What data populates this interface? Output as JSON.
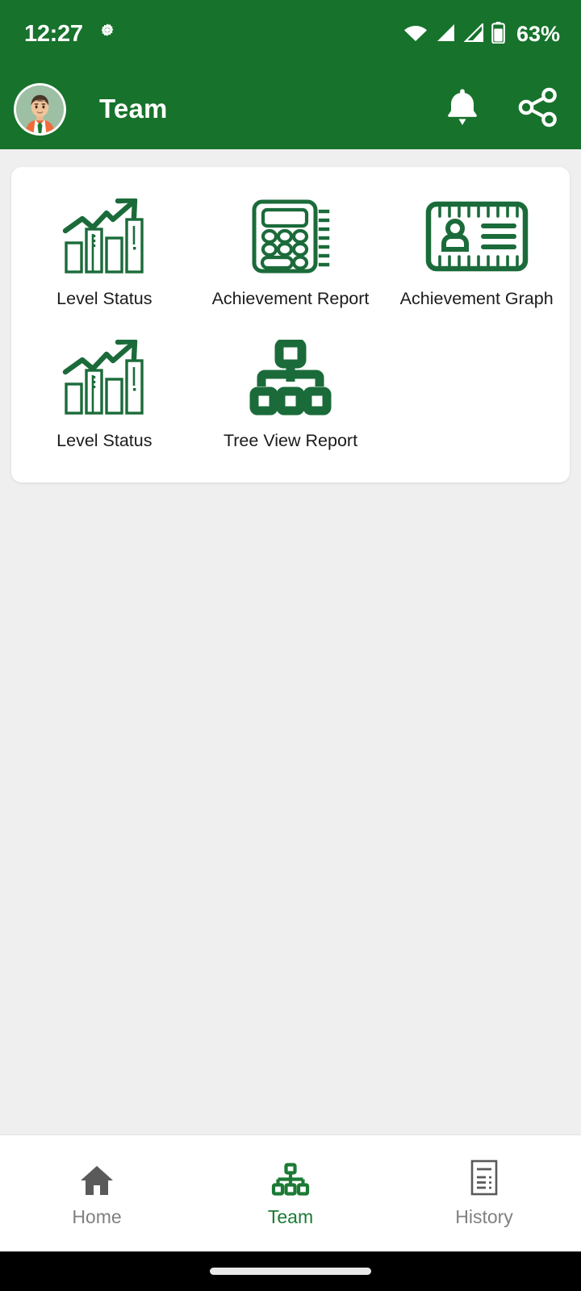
{
  "status_bar": {
    "time": "12:27",
    "battery_percent": "63%",
    "icons": [
      "gear-icon",
      "wifi-icon",
      "signal-icon",
      "signal-icon-2",
      "battery-icon"
    ]
  },
  "app_bar": {
    "title": "Team",
    "avatar_alt": "user-avatar",
    "actions": [
      {
        "name": "notifications-button",
        "icon": "bell-icon"
      },
      {
        "name": "share-button",
        "icon": "share-icon"
      }
    ]
  },
  "menu": {
    "items": [
      {
        "label": "Level Status",
        "icon": "growth-chart-icon"
      },
      {
        "label": "Achievement Report",
        "icon": "calculator-icon"
      },
      {
        "label": "Achievement Graph",
        "icon": "id-card-icon"
      },
      {
        "label": "Level Status",
        "icon": "growth-chart-icon"
      },
      {
        "label": "Tree View Report",
        "icon": "org-chart-icon"
      }
    ]
  },
  "bottom_nav": {
    "items": [
      {
        "label": "Home",
        "icon": "home-icon",
        "active": false
      },
      {
        "label": "Team",
        "icon": "org-chart-icon",
        "active": true
      },
      {
        "label": "History",
        "icon": "document-icon",
        "active": false
      }
    ]
  },
  "colors": {
    "brand_green": "#17722C",
    "icon_green": "#1B6B3A",
    "nav_active_green": "#1B7A35",
    "nav_inactive_gray": "#808080",
    "page_background": "#EFEFEF",
    "card_background": "#FFFFFF",
    "label_text": "#1B1B1B"
  }
}
